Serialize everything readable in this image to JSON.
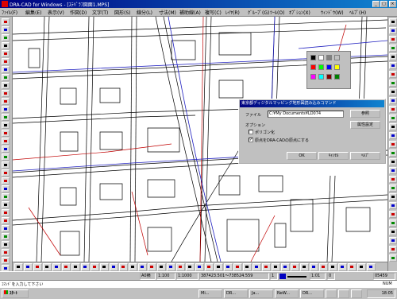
{
  "window": {
    "title": "DRA-CAD for Windows - [ｽﾃﾊﾞﾗﾌ図面1.MPS]"
  },
  "menu": [
    "ﾌｧｲﾙ(F)",
    "編集(E)",
    "表示(V)",
    "作図(D)",
    "文字(T)",
    "図形(S)",
    "線分(L)",
    "寸法(M)",
    "補助線(A)",
    "複写(C)",
    "ﾚｲﾔ(R)",
    "ｸﾞﾙｰﾌﾟ(G)",
    "ﾂｰﾙ(O)",
    "ｵﾌﾟｼｮﾝ(X)",
    "ｳｨﾝﾄﾞｳ(W)",
    "ﾍﾙﾌﾟ(H)"
  ],
  "dialog": {
    "title": "東京都ディジタルマッピング地形図読み込みコマンド",
    "file_label": "ファイル",
    "file_value": "C:¥My Documents¥LD074",
    "browse": "参照",
    "attribute": "属性設定",
    "options_label": "オプション",
    "polygon": "ポリゴン化",
    "origin": "原点をDRA-CADの原点にする",
    "origin_checked": true,
    "ok": "OK",
    "cancel": "ｷｬﾝｾﾙ",
    "help": "ﾍﾙﾌﾟ"
  },
  "status": {
    "mode": "A0横",
    "scale1": "1:100",
    "scale2": "1:1000",
    "coords": "387423.501～738524.559",
    "count": "1",
    "zoom": "1:01",
    "angle": "0",
    "number": "05459"
  },
  "prompt": "ｺﾏﾝﾄﾞを入力して下さい",
  "caps": "NUM",
  "taskbar": {
    "start": "ｽﾀｰﾄ",
    "tasks": [
      "Mi...",
      "DR...",
      "Ja...",
      "NeW...",
      "DR...",
      "",
      "",
      ""
    ],
    "clock": "18:05"
  },
  "colors": {
    "title": "#000080",
    "map_line": "#000000",
    "road_red": "#c00000",
    "road_blue": "#2020c0"
  }
}
